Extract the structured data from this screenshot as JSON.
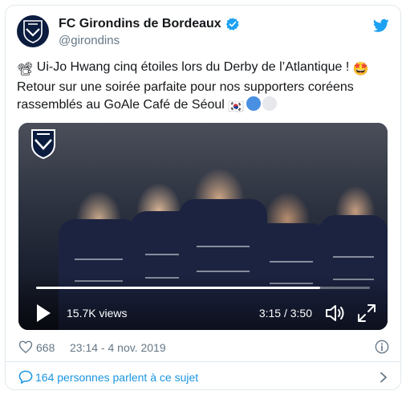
{
  "tweet": {
    "display_name": "FC Girondins de Bordeaux",
    "handle": "@girondins",
    "text_line1": "Ui-Jo Hwang cinq étoiles lors du Derby de l’Atlantique !",
    "text_line2": "Retour sur une soirée parfaite pour nos supporters coréens",
    "text_line3": "rassemblés au GoAle Café de Séoul",
    "emoji_camera": "📽",
    "emoji_star_eyes": "🤩",
    "emoji_flag": "🇰🇷"
  },
  "video": {
    "views": "15.7K views",
    "time": "3:15 / 3:50",
    "progress": 0.85
  },
  "meta": {
    "like_count": "668",
    "timestamp": "23:14 - 4 nov. 2019"
  },
  "conversation": {
    "label": "164 personnes parlent à ce sujet"
  },
  "colors": {
    "accent": "#1da1f2",
    "link": "#1b95e0",
    "muted": "#657786",
    "club_navy": "#0b1c3f"
  },
  "icons": [
    "club-crest-icon",
    "verified-badge-icon",
    "twitter-bird-icon",
    "play-icon",
    "volume-icon",
    "fullscreen-icon",
    "heart-icon",
    "info-icon",
    "speech-bubble-icon",
    "chevron-right-icon"
  ]
}
